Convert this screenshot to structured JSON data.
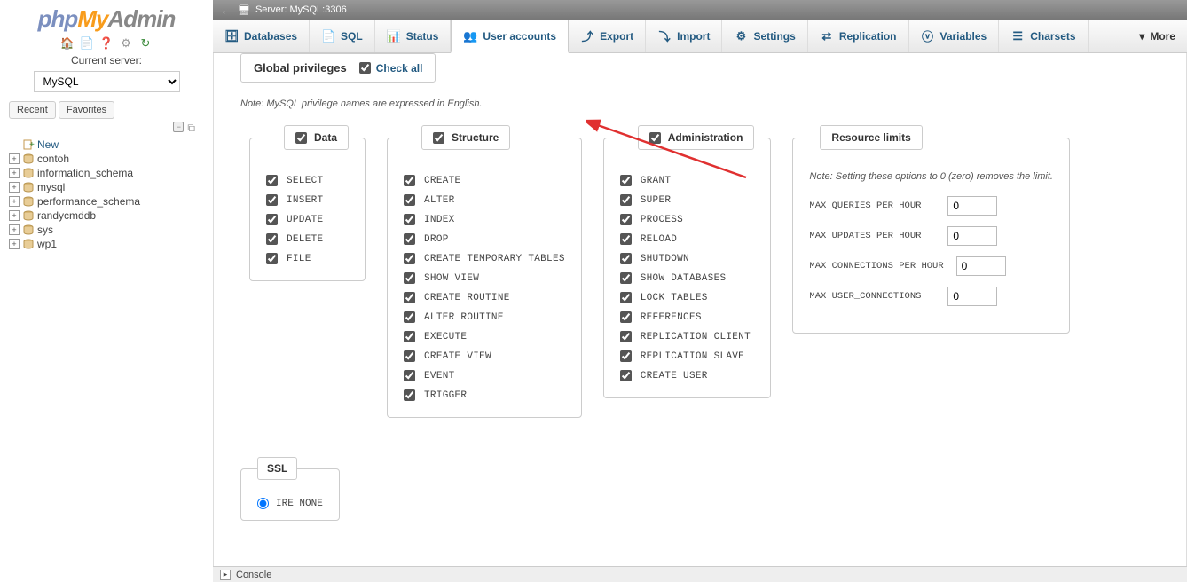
{
  "logo": {
    "php": "php",
    "my": "My",
    "admin": "Admin"
  },
  "sidebar": {
    "server_label": "Current server:",
    "server_value": "MySQL",
    "tabs": {
      "recent": "Recent",
      "favorites": "Favorites"
    },
    "new_label": "New",
    "databases": [
      "contoh",
      "information_schema",
      "mysql",
      "performance_schema",
      "randycmddb",
      "sys",
      "wp1"
    ]
  },
  "topbar": {
    "server_text": "Server: MySQL:3306"
  },
  "nav": {
    "databases": "Databases",
    "sql": "SQL",
    "status": "Status",
    "user_accounts": "User accounts",
    "export": "Export",
    "import": "Import",
    "settings": "Settings",
    "replication": "Replication",
    "variables": "Variables",
    "charsets": "Charsets",
    "more": "More"
  },
  "global_priv": {
    "title": "Global privileges",
    "check_all": "Check all"
  },
  "note": "Note: MySQL privilege names are expressed in English.",
  "groups": {
    "data": {
      "title": "Data",
      "items": [
        "SELECT",
        "INSERT",
        "UPDATE",
        "DELETE",
        "FILE"
      ]
    },
    "structure": {
      "title": "Structure",
      "items": [
        "CREATE",
        "ALTER",
        "INDEX",
        "DROP",
        "CREATE TEMPORARY TABLES",
        "SHOW VIEW",
        "CREATE ROUTINE",
        "ALTER ROUTINE",
        "EXECUTE",
        "CREATE VIEW",
        "EVENT",
        "TRIGGER"
      ]
    },
    "admin": {
      "title": "Administration",
      "items": [
        "GRANT",
        "SUPER",
        "PROCESS",
        "RELOAD",
        "SHUTDOWN",
        "SHOW DATABASES",
        "LOCK TABLES",
        "REFERENCES",
        "REPLICATION CLIENT",
        "REPLICATION SLAVE",
        "CREATE USER"
      ]
    }
  },
  "rlimits": {
    "title": "Resource limits",
    "note": "Note: Setting these options to 0 (zero) removes the limit.",
    "rows": [
      {
        "label": "MAX QUERIES PER HOUR",
        "value": "0"
      },
      {
        "label": "MAX UPDATES PER HOUR",
        "value": "0"
      },
      {
        "label": "MAX CONNECTIONS PER HOUR",
        "value": "0"
      },
      {
        "label": "MAX USER_CONNECTIONS",
        "value": "0"
      }
    ]
  },
  "ssl": {
    "title": "SSL",
    "require_none": "IRE NONE"
  },
  "bottombar": {
    "console": "Console"
  }
}
